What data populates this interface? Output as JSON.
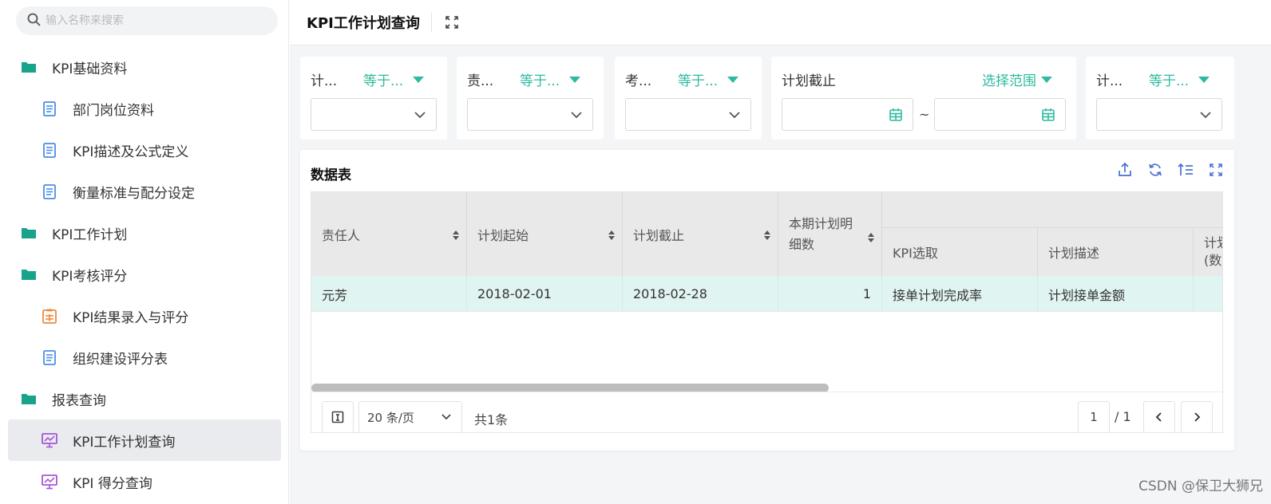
{
  "sidebar": {
    "search_placeholder": "输入名称来搜索",
    "items": [
      {
        "label": "KPI基础资料",
        "type": "folder"
      },
      {
        "label": "部门岗位资料",
        "type": "doc"
      },
      {
        "label": "KPI描述及公式定义",
        "type": "doc"
      },
      {
        "label": "衡量标准与配分设定",
        "type": "doc"
      },
      {
        "label": "KPI工作计划",
        "type": "folder"
      },
      {
        "label": "KPI考核评分",
        "type": "folder"
      },
      {
        "label": "KPI结果录入与评分",
        "type": "form"
      },
      {
        "label": "组织建设评分表",
        "type": "doc"
      },
      {
        "label": "报表查询",
        "type": "folder"
      },
      {
        "label": "KPI工作计划查询",
        "type": "report",
        "active": true
      },
      {
        "label": "KPI 得分查询",
        "type": "report"
      }
    ]
  },
  "header": {
    "title": "KPI工作计划查询"
  },
  "filters": [
    {
      "label": "计...",
      "operator": "等于...",
      "value": ""
    },
    {
      "label": "责...",
      "operator": "等于...",
      "value": ""
    },
    {
      "label": "考...",
      "operator": "等于...",
      "value": ""
    },
    {
      "label": "计划截止",
      "operator": "选择范围",
      "from": "",
      "to": "",
      "range_sep": "~"
    },
    {
      "label": "计...",
      "operator": "等于...",
      "value": ""
    }
  ],
  "table": {
    "title": "数据表",
    "columns": [
      "责任人",
      "计划起始",
      "计划截止",
      "本期计划明细数",
      "KPI选取",
      "计划描述",
      "计划"
    ],
    "columns_extra": "(数",
    "rows": [
      {
        "owner": "元芳",
        "start": "2018-02-01",
        "end": "2018-02-28",
        "count": "1",
        "kpi": "接单计划完成率",
        "desc": "计划接单金额"
      }
    ]
  },
  "pager": {
    "page_size": "20 条/页",
    "total": "共1条",
    "current_page": "1",
    "total_pages": "/ 1"
  },
  "watermark": "CSDN @保卫大狮兄",
  "colors": {
    "accent": "#2ebaa0",
    "folder": "#1aa38b",
    "doc": "#4a8fe7",
    "form": "#f0883e",
    "report": "#a557d6"
  }
}
